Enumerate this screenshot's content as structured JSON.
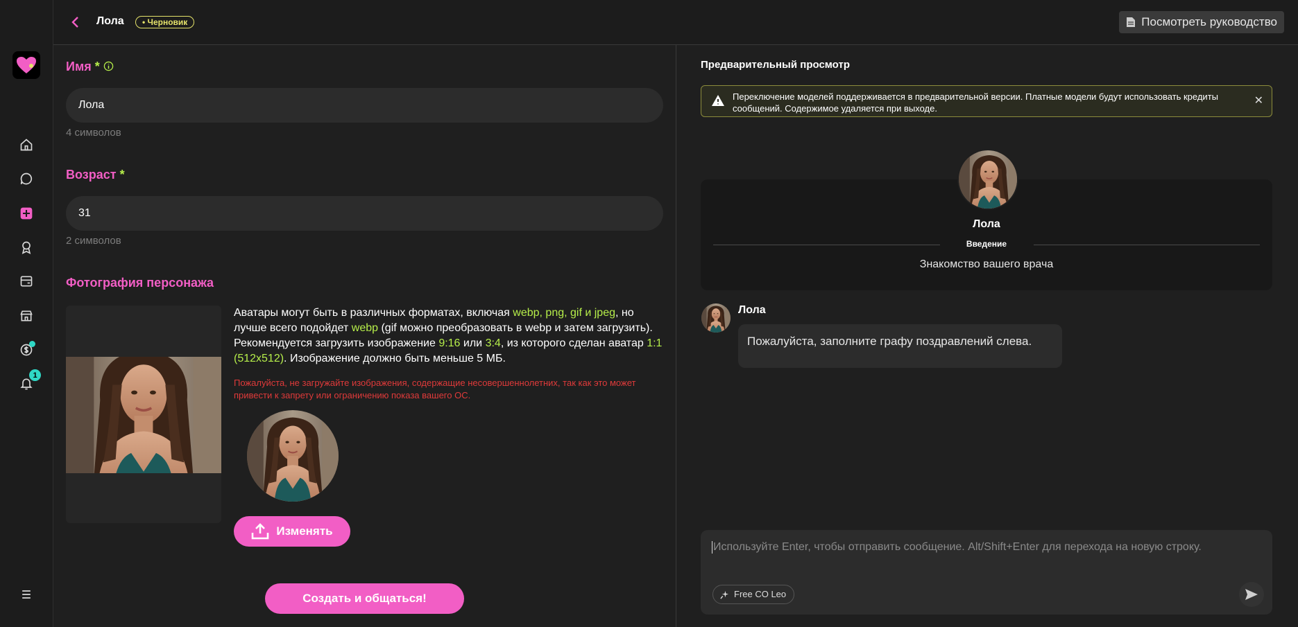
{
  "header": {
    "character_name": "Лола",
    "draft_badge": "• Черновик",
    "guide_button": "Посмотреть руководство"
  },
  "sidebar": {
    "icons": [
      "home-icon",
      "chat-icon",
      "create-icon",
      "badge-icon",
      "card-icon",
      "store-icon",
      "coin-icon",
      "bell-icon",
      "menu-icon"
    ],
    "notification_count": "1"
  },
  "form": {
    "name_label": "Имя",
    "name_required": "*",
    "name_value": "Лола",
    "name_count": "4 символов",
    "age_label": "Возраст",
    "age_required": "*",
    "age_value": "31",
    "age_count": "2 символов",
    "photo_label": "Фотография персонажа",
    "desc": {
      "p1": "Аватары могут быть в различных форматах, включая ",
      "formats": "webp, png, gif и jpeg",
      "p2": ", но лучше всего подойдет ",
      "webp": "webp",
      "p3": " (gif можно преобразовать в webp и затем загрузить). Рекомендуется загрузить изображение ",
      "r1": "9:16",
      "p4": " или ",
      "r2": "3:4",
      "p5": ", из которого сделан аватар ",
      "r3": "1:1 (512x512)",
      "p6": ". Изображение должно быть меньше 5 МБ."
    },
    "warning": "Пожалуйста, не загружайте изображения, содержащие несовершеннолетних, так как это может привести к запрету или ограничению показа вашего ОС.",
    "change_button": "Изменять",
    "create_button": "Создать и общаться!"
  },
  "preview": {
    "title": "Предварительный просмотр",
    "alert": "Переключение моделей поддерживается в предварительной версии. Платные модели будут использовать кредиты сообщений. Содержимое удаляется при выходе.",
    "intro_name": "Лола",
    "intro_label": "Введение",
    "intro_text": "Знакомство вашего врача",
    "message_author": "Лола",
    "message_text": "Пожалуйста, заполните графу поздравлений слева.",
    "composer_placeholder": "Используйте Enter, чтобы отправить сообщение. Alt/Shift+Enter для перехода на новую строку.",
    "model_pill": "Free CO Leo"
  },
  "colors": {
    "accent_pink": "#f25ec5",
    "accent_green": "#b6ee4a",
    "warning_red": "#e03a3a",
    "badge_yellow": "#e5e36a",
    "notification_teal": "#2fd8c5"
  }
}
